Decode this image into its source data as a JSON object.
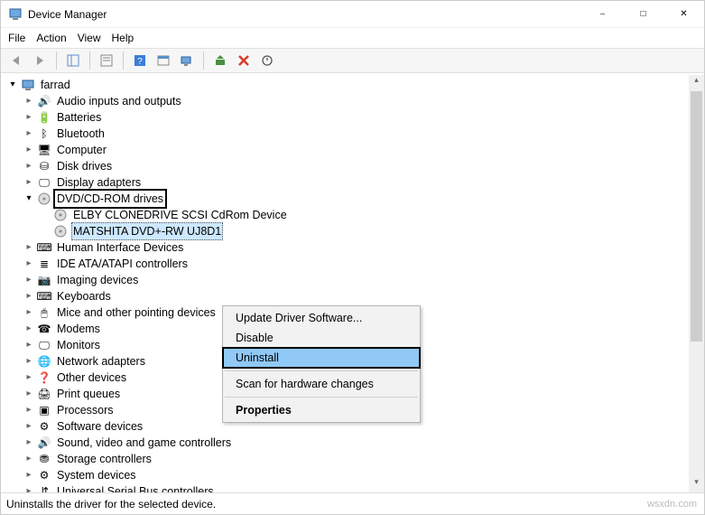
{
  "window": {
    "title": "Device Manager"
  },
  "menu": {
    "file": "File",
    "action": "Action",
    "view": "View",
    "help": "Help"
  },
  "tree": {
    "root": "farrad",
    "items": [
      "Audio inputs and outputs",
      "Batteries",
      "Bluetooth",
      "Computer",
      "Disk drives",
      "Display adapters"
    ],
    "dvd": {
      "label": "DVD/CD-ROM drives",
      "children": [
        "ELBY CLONEDRIVE SCSI CdRom Device",
        "MATSHITA DVD+-RW UJ8D1"
      ]
    },
    "rest": [
      "Human Interface Devices",
      "IDE ATA/ATAPI controllers",
      "Imaging devices",
      "Keyboards",
      "Mice and other pointing devices",
      "Modems",
      "Monitors",
      "Network adapters",
      "Other devices",
      "Print queues",
      "Processors",
      "Software devices",
      "Sound, video and game controllers",
      "Storage controllers",
      "System devices",
      "Universal Serial Bus controllers"
    ]
  },
  "context": {
    "update": "Update Driver Software...",
    "disable": "Disable",
    "uninstall": "Uninstall",
    "scan": "Scan for hardware changes",
    "properties": "Properties"
  },
  "status": {
    "text": "Uninstalls the driver for the selected device."
  },
  "watermark": "wsxdn.com"
}
